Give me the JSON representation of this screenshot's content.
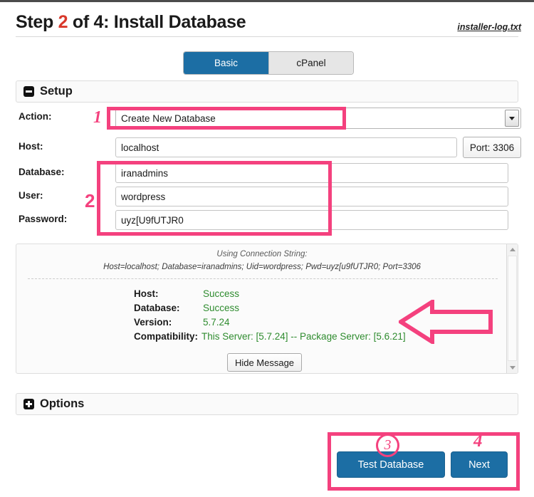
{
  "header": {
    "title_prefix": "Step ",
    "step_number": "2",
    "title_suffix": " of 4: Install Database",
    "log_link": "installer-log.txt"
  },
  "tabs": [
    {
      "label": "Basic",
      "active": true
    },
    {
      "label": "cPanel",
      "active": false
    }
  ],
  "panels": {
    "setup": {
      "title": "Setup",
      "state": "expanded",
      "icon": "minus-icon"
    },
    "options": {
      "title": "Options",
      "state": "collapsed",
      "icon": "plus-icon"
    }
  },
  "form": {
    "action": {
      "label": "Action:",
      "value": "Create New Database"
    },
    "host": {
      "label": "Host:",
      "value": "localhost",
      "port_button": "Port: 3306"
    },
    "database": {
      "label": "Database:",
      "value": "iranadmins"
    },
    "user": {
      "label": "User:",
      "value": "wordpress"
    },
    "password": {
      "label": "Password:",
      "value": "uyz[U9fUTJR0"
    }
  },
  "message_panel": {
    "conn_title": "Using Connection String:",
    "conn_string": "Host=localhost; Database=iranadmins; Uid=wordpress; Pwd=uyz[u9fUTJR0; Port=3306",
    "rows": [
      {
        "key": "Host:",
        "value": "Success"
      },
      {
        "key": "Database:",
        "value": "Success"
      },
      {
        "key": "Version:",
        "value": "5.7.24"
      },
      {
        "key": "Compatibility:",
        "value": "This Server: [5.7.24] -- Package Server: [5.6.21]"
      }
    ],
    "hide_button": "Hide Message"
  },
  "actions": {
    "test_database": "Test Database",
    "next": "Next"
  },
  "annotations": {
    "one": "1",
    "two": "2",
    "three": "3",
    "four": "4"
  },
  "colors": {
    "accent_blue": "#1c6ea4",
    "annotation_pink": "#f4417e",
    "success_green": "#2f8c2f",
    "step_red": "#d9382b"
  }
}
